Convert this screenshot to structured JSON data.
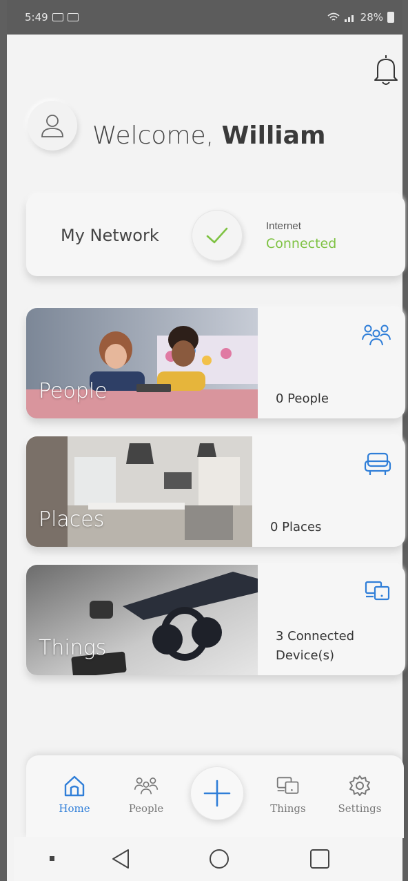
{
  "status_bar": {
    "time": "5:49",
    "battery": "28%"
  },
  "header": {
    "greeting": "Welcome,",
    "user_name": "William"
  },
  "network_card": {
    "label": "My Network",
    "internet_label": "Internet",
    "internet_status": "Connected",
    "status_color": "#7ec242"
  },
  "tiles": [
    {
      "title": "People",
      "count": "0 People",
      "icon": "people-icon"
    },
    {
      "title": "Places",
      "count": "0 Places",
      "icon": "sofa-icon"
    },
    {
      "title": "Things",
      "count": "3 Connected Device(s)",
      "icon": "devices-icon"
    }
  ],
  "bottom_nav": {
    "items": [
      {
        "label": "Home",
        "icon": "home-icon",
        "active": true
      },
      {
        "label": "People",
        "icon": "people-icon",
        "active": false
      },
      {
        "label": "Things",
        "icon": "devices-icon",
        "active": false
      },
      {
        "label": "Settings",
        "icon": "gear-icon",
        "active": false
      }
    ],
    "add_icon": "plus-icon"
  },
  "colors": {
    "accent": "#2f7ed8",
    "connected": "#7ec242",
    "background": "#f3f3f3"
  }
}
